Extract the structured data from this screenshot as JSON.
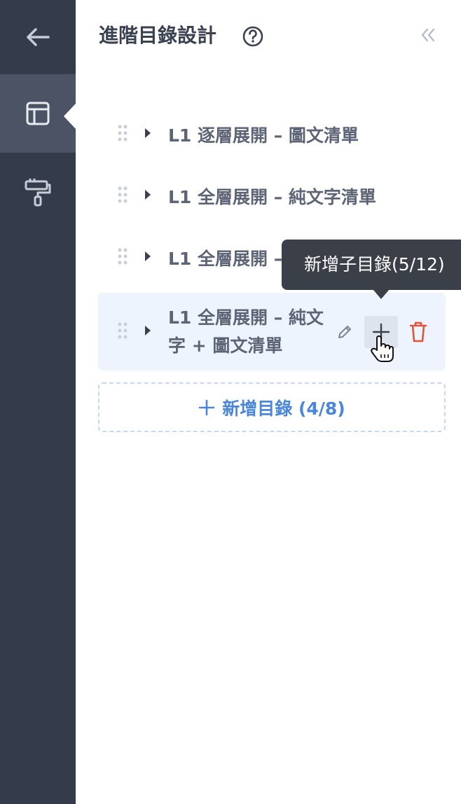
{
  "header": {
    "title": "進階目錄設計"
  },
  "directories": [
    {
      "label": "L1 逐層展開 – 圖文清單"
    },
    {
      "label": "L1 全層展開 – 純文字清單"
    },
    {
      "label": "L1 全層展開 – 圖文清單"
    },
    {
      "label": "L1 全層展開 – 純文字 + 圖文清單"
    }
  ],
  "add_directory": {
    "label": "新增目錄 (4/8)"
  },
  "tooltip": {
    "text": "新增子目錄(5/12)"
  },
  "colors": {
    "sidebar": "#343b4b",
    "sidebar_active": "#4b5364",
    "accent": "#4a86dc",
    "danger": "#e0533d",
    "tooltip_bg": "#3b3f47"
  },
  "icons": {
    "back": "arrow-left-icon",
    "layout": "layout-icon",
    "style": "paint-roller-icon",
    "help": "question-circle-icon",
    "collapse": "double-chevron-left-icon",
    "drag": "drag-handle-icon",
    "expand": "caret-right-icon",
    "edit": "pencil-icon",
    "add_child": "plus-icon",
    "delete": "trash-icon"
  }
}
